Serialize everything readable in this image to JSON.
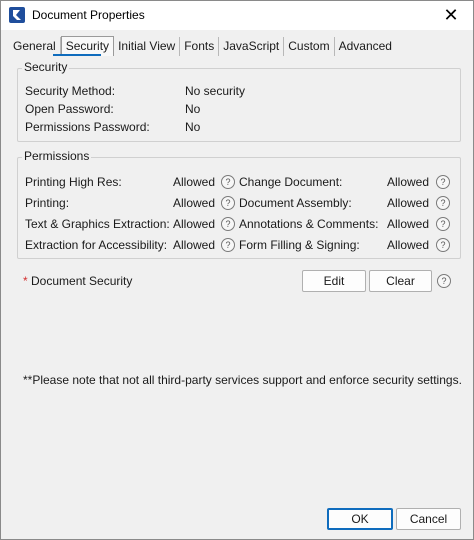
{
  "window": {
    "title": "Document Properties",
    "close_glyph": "✕"
  },
  "tabs": [
    {
      "label": "General"
    },
    {
      "label": "Security"
    },
    {
      "label": "Initial View"
    },
    {
      "label": "Fonts"
    },
    {
      "label": "JavaScript"
    },
    {
      "label": "Custom"
    },
    {
      "label": "Advanced"
    }
  ],
  "security": {
    "group_title": "Security",
    "rows": [
      {
        "label": "Security Method:",
        "value": "No security"
      },
      {
        "label": "Open Password:",
        "value": "No"
      },
      {
        "label": "Permissions Password:",
        "value": "No"
      }
    ]
  },
  "permissions": {
    "group_title": "Permissions",
    "left": [
      {
        "label": "Printing High Res:",
        "value": "Allowed"
      },
      {
        "label": "Printing:",
        "value": "Allowed"
      },
      {
        "label": "Text & Graphics Extraction:",
        "value": "Allowed"
      },
      {
        "label": "Extraction for Accessibility:",
        "value": "Allowed"
      }
    ],
    "right": [
      {
        "label": "Change Document:",
        "value": "Allowed"
      },
      {
        "label": "Document Assembly:",
        "value": "Allowed"
      },
      {
        "label": "Annotations & Comments:",
        "value": "Allowed"
      },
      {
        "label": "Form Filling & Signing:",
        "value": "Allowed"
      }
    ]
  },
  "document_security": {
    "asterisk": "*",
    "label": "Document Security",
    "edit": "Edit",
    "clear": "Clear"
  },
  "help_glyph": "?",
  "note": "**Please note that not all third-party services support and enforce security settings.",
  "footer": {
    "ok": "OK",
    "cancel": "Cancel"
  },
  "colors": {
    "accent": "#0f6cbd",
    "required": "#d32f2f"
  }
}
